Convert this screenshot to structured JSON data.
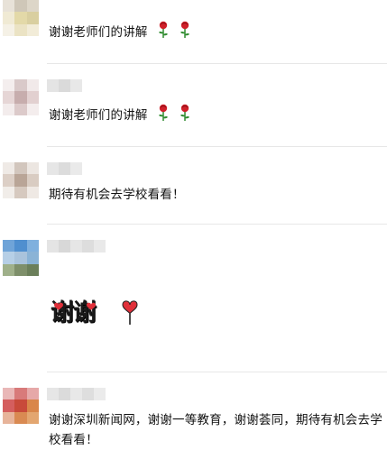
{
  "comments": [
    {
      "text": "谢谢老师们的讲解",
      "emoji": [
        "rose-icon",
        "rose-icon"
      ]
    },
    {
      "text": "谢谢老师们的讲解",
      "emoji": [
        "rose-icon",
        "rose-icon"
      ]
    },
    {
      "text": "期待有机会去学校看看！"
    },
    {
      "sticker_text": "谢谢",
      "sticker_icon": "heart-lollipop-icon"
    },
    {
      "text": "谢谢深圳新闻网，谢谢一等教育，谢谢荟同，期待有机会去学校看看！"
    }
  ],
  "colors": {
    "divider": "#e7e7e7",
    "rose_red": "#d0202a",
    "stem_green": "#2e8b2e",
    "heart_red": "#e0303a"
  }
}
